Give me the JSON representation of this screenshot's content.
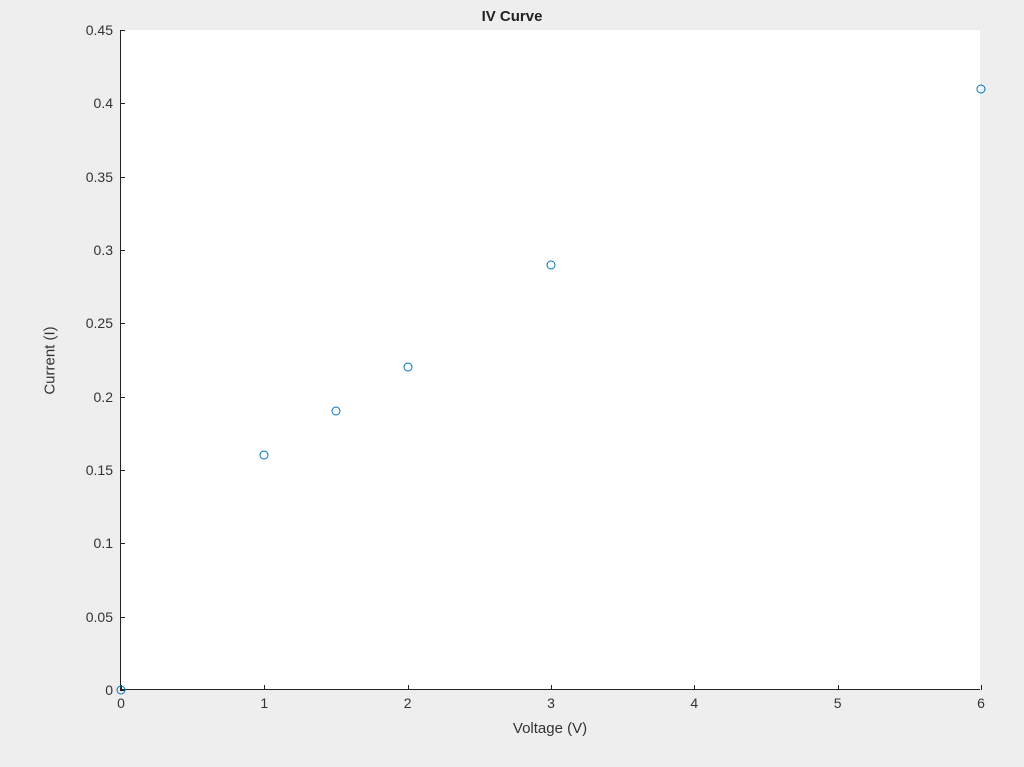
{
  "chart_data": {
    "type": "scatter",
    "title": "IV Curve",
    "xlabel": "Voltage (V)",
    "ylabel": "Current (I)",
    "xlim": [
      0,
      6
    ],
    "ylim": [
      0,
      0.45
    ],
    "xticks": [
      0,
      1,
      2,
      3,
      4,
      5,
      6
    ],
    "yticks": [
      0,
      0.05,
      0.1,
      0.15,
      0.2,
      0.25,
      0.3,
      0.35,
      0.4,
      0.45
    ],
    "series": [
      {
        "name": "data",
        "marker_color": "#0072BD",
        "x": [
          0,
          1,
          1.5,
          2,
          3,
          6
        ],
        "y": [
          0,
          0.16,
          0.19,
          0.22,
          0.29,
          0.41
        ]
      }
    ]
  }
}
